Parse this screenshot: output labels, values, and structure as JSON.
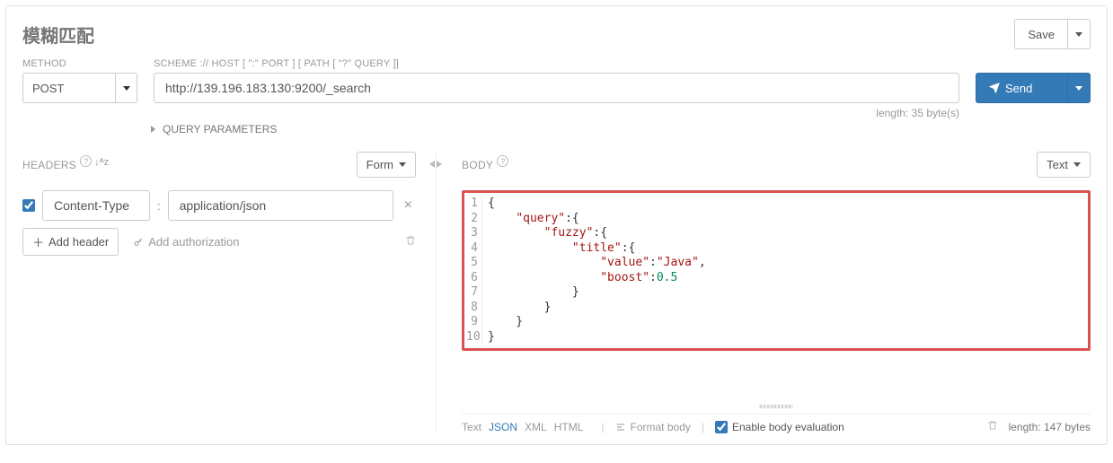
{
  "title": "模糊匹配",
  "save": {
    "label": "Save"
  },
  "method": {
    "label": "METHOD",
    "value": "POST"
  },
  "url": {
    "label": "SCHEME :// HOST [ \":\" PORT ] [ PATH [ \"?\" QUERY ]]",
    "value": "http://139.196.183.130:9200/_search",
    "length": "length: 35 byte(s)"
  },
  "send": {
    "label": "Send"
  },
  "query_params": {
    "label": "QUERY PARAMETERS"
  },
  "headers": {
    "label": "HEADERS",
    "mode": "Form",
    "items": [
      {
        "enabled": true,
        "name": "Content-Type",
        "value": "application/json"
      }
    ],
    "add_header": "Add header",
    "add_auth": "Add authorization"
  },
  "body": {
    "label": "BODY",
    "mode": "Text",
    "lines": [
      {
        "n": 1,
        "indent": 0,
        "type": "brace",
        "text": "{"
      },
      {
        "n": 2,
        "indent": 1,
        "type": "keybrace",
        "key": "query"
      },
      {
        "n": 3,
        "indent": 2,
        "type": "keybrace",
        "key": "fuzzy"
      },
      {
        "n": 4,
        "indent": 3,
        "type": "keybrace",
        "key": "title"
      },
      {
        "n": 5,
        "indent": 4,
        "type": "kvs",
        "key": "value",
        "val": "Java"
      },
      {
        "n": 6,
        "indent": 4,
        "type": "kvn",
        "key": "boost",
        "val": "0.5"
      },
      {
        "n": 7,
        "indent": 3,
        "type": "brace",
        "text": "}"
      },
      {
        "n": 8,
        "indent": 2,
        "type": "brace",
        "text": "}"
      },
      {
        "n": 9,
        "indent": 1,
        "type": "brace",
        "text": "}"
      },
      {
        "n": 10,
        "indent": 0,
        "type": "brace",
        "text": "}"
      }
    ],
    "footer": {
      "modes": [
        "Text",
        "JSON",
        "XML",
        "HTML"
      ],
      "active_mode": "JSON",
      "format": "Format body",
      "enable_eval": "Enable body evaluation",
      "eval_checked": true,
      "length": "length: 147 bytes"
    }
  }
}
